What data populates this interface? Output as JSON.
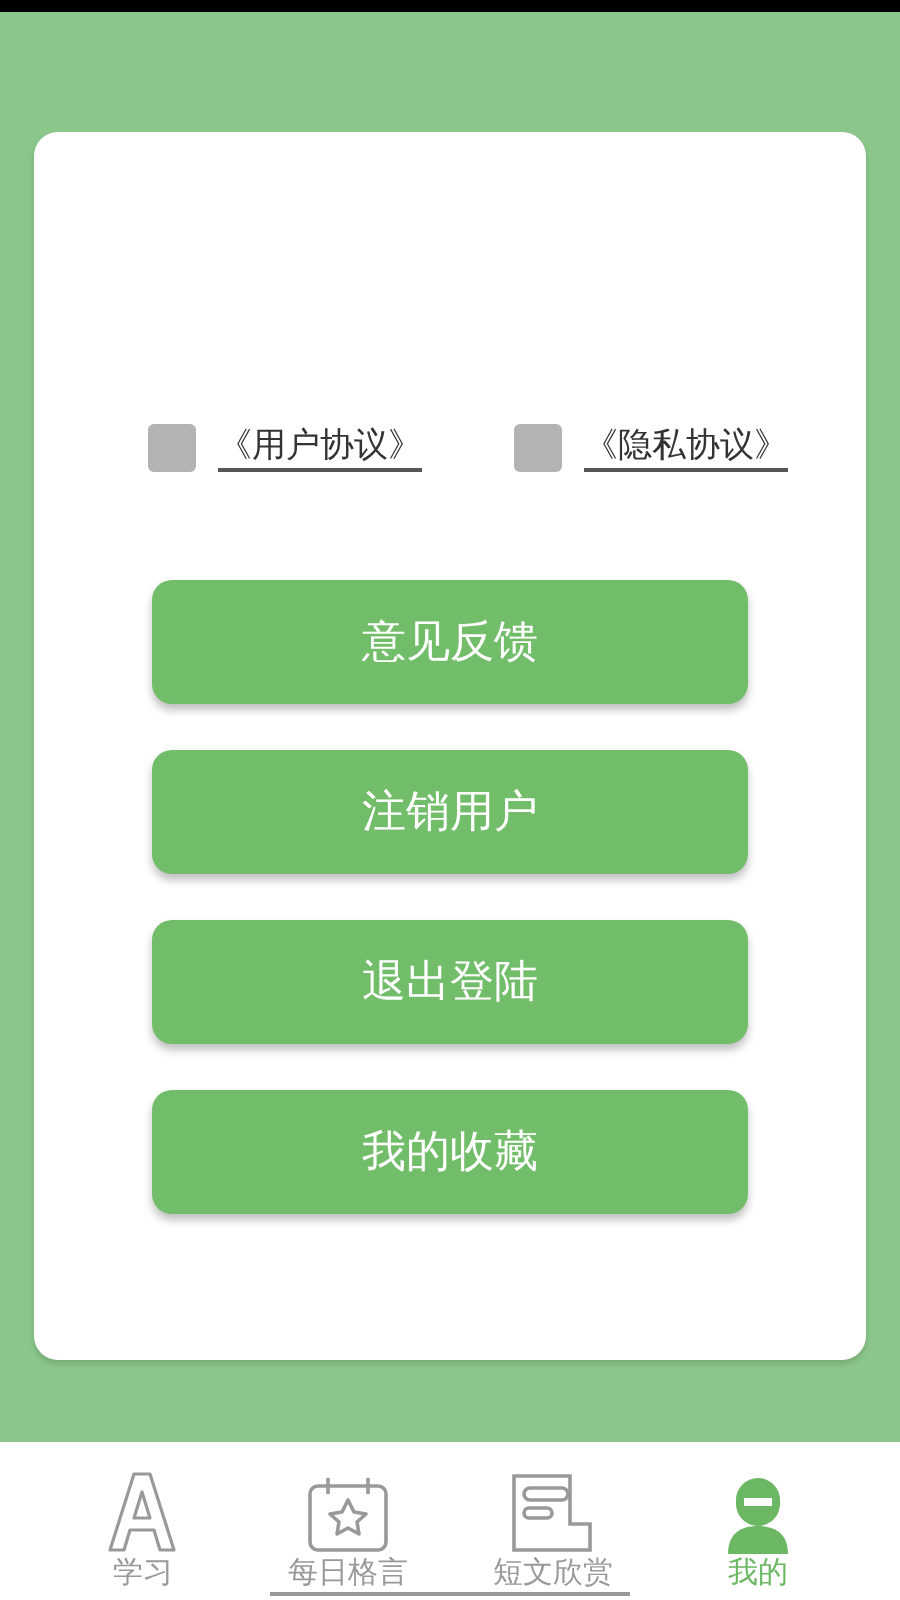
{
  "agreements": [
    {
      "label": "《用户协议》",
      "checked": false
    },
    {
      "label": "《隐私协议》",
      "checked": false
    }
  ],
  "buttons": [
    "意见反馈",
    "注销用户",
    "退出登陆",
    "我的收藏"
  ],
  "tabs": [
    {
      "kind": "letter",
      "label": "学习",
      "selected": false
    },
    {
      "kind": "calendar",
      "label": "每日格言",
      "selected": false
    },
    {
      "kind": "article",
      "label": "短文欣赏",
      "selected": false
    },
    {
      "kind": "person",
      "label": "我的",
      "selected": true
    }
  ]
}
